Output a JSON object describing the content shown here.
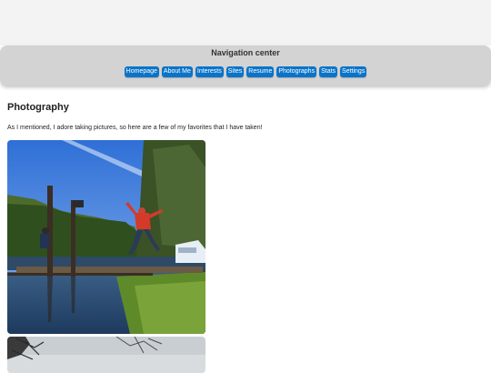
{
  "nav": {
    "title": "Navigation center",
    "buttons": [
      "Homepage",
      "About Me",
      "Interests",
      "Sites",
      "Resume",
      "Photographs",
      "Stats",
      "Settings"
    ]
  },
  "main": {
    "heading": "Photography",
    "intro": "As I mentioned, I adore taking pictures, so here are a few of my favorites that I have taken!"
  },
  "colors": {
    "nav_button": "#0a74c9",
    "navbar": "#d3d3d3",
    "top_band": "#f3f3f3"
  }
}
